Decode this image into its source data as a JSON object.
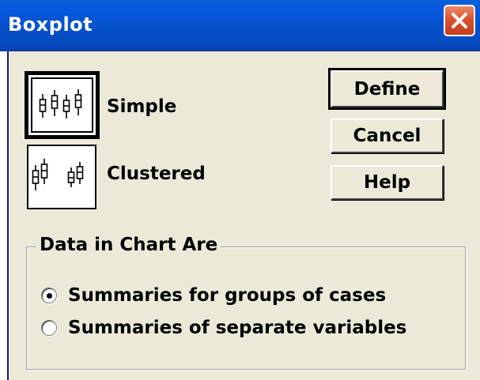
{
  "window": {
    "title": "Boxplot",
    "close_icon": "close-icon"
  },
  "chart_types": [
    {
      "label": "Simple",
      "icon": "simple-boxplot-icon",
      "selected": true
    },
    {
      "label": "Clustered",
      "icon": "clustered-boxplot-icon",
      "selected": false
    }
  ],
  "buttons": {
    "define": "Define",
    "cancel": "Cancel",
    "help": "Help"
  },
  "data_group": {
    "title": "Data in Chart Are",
    "options": [
      {
        "label": "Summaries for groups of cases",
        "selected": true
      },
      {
        "label": "Summaries of separate variables",
        "selected": false
      }
    ]
  },
  "colors": {
    "titlebar": "#0a5fd8",
    "dialog_bg": "#ece9d8",
    "close_button": "#d9542f"
  }
}
